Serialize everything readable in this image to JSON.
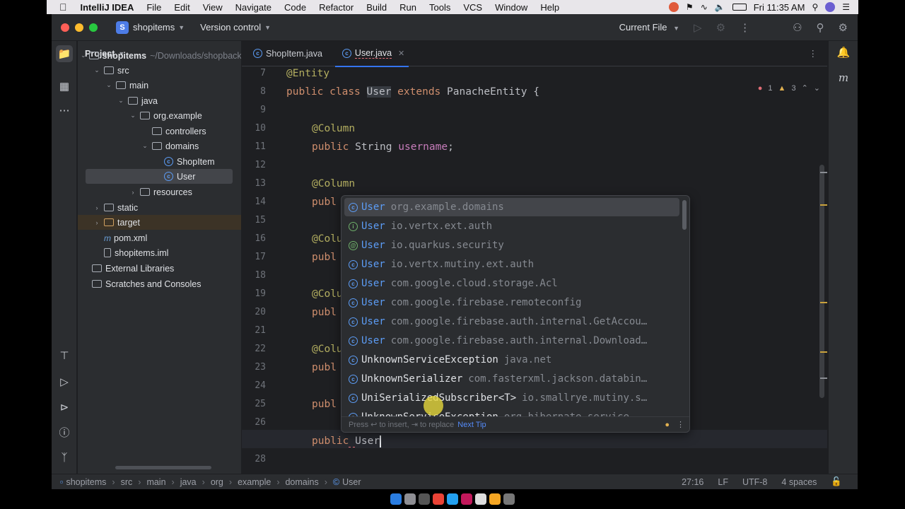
{
  "menubar": {
    "app_name": "IntelliJ IDEA",
    "items": [
      "File",
      "Edit",
      "View",
      "Navigate",
      "Code",
      "Refactor",
      "Build",
      "Run",
      "Tools",
      "VCS",
      "Window",
      "Help"
    ],
    "clock": "Fri 11:35 AM"
  },
  "titlebar": {
    "project_badge": "S",
    "project_name": "shopitems",
    "version_control": "Version control",
    "run_config": "Current File"
  },
  "project_panel": {
    "title": "Project",
    "tree": [
      {
        "label": "shopitems",
        "extra": "~/Downloads/shopbacke",
        "type": "module",
        "depth": 0,
        "expanded": true
      },
      {
        "label": "src",
        "type": "folder",
        "depth": 1,
        "expanded": true
      },
      {
        "label": "main",
        "type": "folder",
        "depth": 2,
        "expanded": true
      },
      {
        "label": "java",
        "type": "folder",
        "depth": 3,
        "expanded": true
      },
      {
        "label": "org.example",
        "type": "folder",
        "depth": 4,
        "expanded": true
      },
      {
        "label": "controllers",
        "type": "folder",
        "depth": 5
      },
      {
        "label": "domains",
        "type": "folder",
        "depth": 5,
        "expanded": true
      },
      {
        "label": "ShopItem",
        "type": "class",
        "depth": 6
      },
      {
        "label": "User",
        "type": "class",
        "depth": 6,
        "selected": true
      },
      {
        "label": "resources",
        "type": "folder",
        "depth": 4,
        "collapsed": true
      },
      {
        "label": "static",
        "type": "folder",
        "depth": 1,
        "collapsed": true
      },
      {
        "label": "target",
        "type": "folder",
        "depth": 1,
        "collapsed": true,
        "excluded": true
      },
      {
        "label": "pom.xml",
        "type": "maven",
        "depth": 1
      },
      {
        "label": "shopitems.iml",
        "type": "file",
        "depth": 1
      },
      {
        "label": "External Libraries",
        "type": "lib",
        "depth": 0
      },
      {
        "label": "Scratches and Consoles",
        "type": "scratch",
        "depth": 0
      }
    ]
  },
  "tabs": [
    {
      "label": "ShopItem.java",
      "active": false
    },
    {
      "label": "User.java",
      "active": true
    }
  ],
  "inspections": {
    "errors": "1",
    "warnings": "3"
  },
  "editor": {
    "line_numbers": [
      "7",
      "8",
      "9",
      "10",
      "11",
      "12",
      "13",
      "14",
      "15",
      "16",
      "17",
      "18",
      "19",
      "20",
      "21",
      "22",
      "23",
      "24",
      "25",
      "26",
      "27",
      "28"
    ],
    "current_line": "27",
    "lines": {
      "l7": "@Entity",
      "l8_public": "public",
      "l8_class": "class",
      "l8_name": "User",
      "l8_extends": "extends",
      "l8_rest": "PanacheEntity {",
      "l10": "@Column",
      "l11_kw": "public",
      "l11_type": "String",
      "l11_field": "username",
      "l11_end": ";",
      "l13": "@Column",
      "l14": "publ",
      "l16": "@Colu",
      "l17": "publ",
      "l19": "@Colu",
      "l20": "publ",
      "l22": "@Colu",
      "l23": "publ",
      "l25": "publ",
      "l27_kw": "public",
      "l27_typed": "User"
    }
  },
  "completion": {
    "items": [
      {
        "match": "User",
        "rest": "",
        "pkg": "org.example.domains",
        "icon": "class-icon"
      },
      {
        "match": "User",
        "rest": "",
        "pkg": "io.vertx.ext.auth",
        "icon": "interface-icon"
      },
      {
        "match": "User",
        "rest": "",
        "pkg": "io.quarkus.security",
        "icon": "annotation-icon"
      },
      {
        "match": "User",
        "rest": "",
        "pkg": "io.vertx.mutiny.ext.auth",
        "icon": "class-icon"
      },
      {
        "match": "User",
        "rest": "",
        "pkg": "com.google.cloud.storage.Acl",
        "icon": "class-icon"
      },
      {
        "match": "User",
        "rest": "",
        "pkg": "com.google.firebase.remoteconfig",
        "icon": "class-icon"
      },
      {
        "match": "User",
        "rest": "",
        "pkg": "com.google.firebase.auth.internal.GetAccou…",
        "icon": "class-icon"
      },
      {
        "match": "User",
        "rest": "",
        "pkg": "com.google.firebase.auth.internal.Download…",
        "icon": "class-icon"
      },
      {
        "match": "",
        "rest": "UnknownServiceException",
        "pkg": "java.net",
        "icon": "class-icon"
      },
      {
        "match": "",
        "rest": "UnknownSerializer",
        "pkg": "com.fasterxml.jackson.databin…",
        "icon": "class-icon"
      },
      {
        "match": "",
        "rest": "UniSerializedSubscriber<T>",
        "pkg": "io.smallrye.mutiny.s…",
        "icon": "class-icon"
      },
      {
        "match": "",
        "rest": "UnknownServiceException",
        "pkg": "org.hibernate.service",
        "icon": "class-icon"
      }
    ],
    "footer_hint": "Press ↩ to insert, ⇥ to replace",
    "footer_link": "Next Tip"
  },
  "statusbar": {
    "breadcrumb": [
      "shopitems",
      "src",
      "main",
      "java",
      "org",
      "example",
      "domains",
      "User"
    ],
    "position": "27:16",
    "line_sep": "LF",
    "encoding": "UTF-8",
    "indent": "4 spaces"
  },
  "colors": {
    "accent": "#3574f0",
    "editor_bg": "#1e1f22",
    "panel_bg": "#2b2d30",
    "keyword": "#cf8e6d",
    "annotation": "#b3ae60",
    "field": "#c77dbb",
    "match": "#5c9cf5"
  }
}
